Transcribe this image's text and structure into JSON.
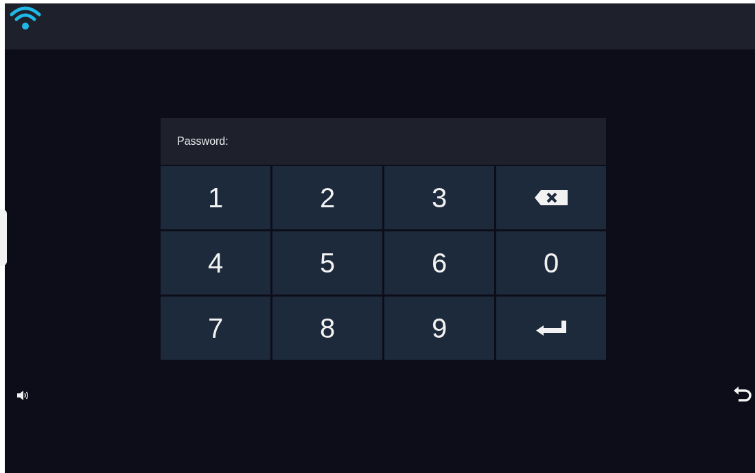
{
  "password_field": {
    "label": "Password:"
  },
  "keys": [
    {
      "kind": "digit",
      "label": "1"
    },
    {
      "kind": "digit",
      "label": "2"
    },
    {
      "kind": "digit",
      "label": "3"
    },
    {
      "kind": "backspace"
    },
    {
      "kind": "digit",
      "label": "4"
    },
    {
      "kind": "digit",
      "label": "5"
    },
    {
      "kind": "digit",
      "label": "6"
    },
    {
      "kind": "digit",
      "label": "0"
    },
    {
      "kind": "digit",
      "label": "7"
    },
    {
      "kind": "digit",
      "label": "8"
    },
    {
      "kind": "digit",
      "label": "9"
    },
    {
      "kind": "enter"
    }
  ]
}
